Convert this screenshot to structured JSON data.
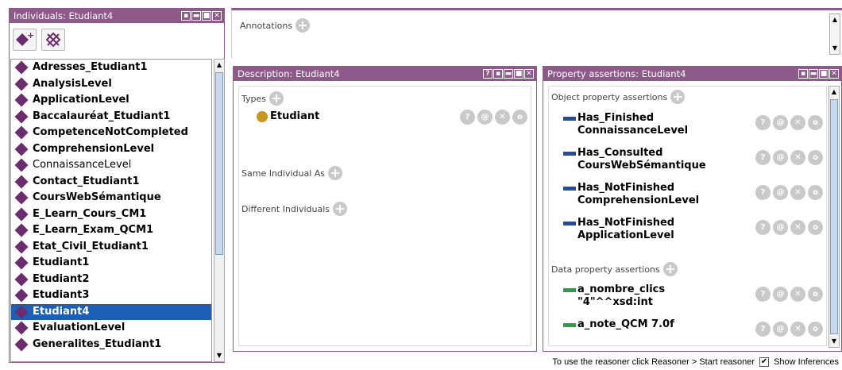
{
  "individuals_panel": {
    "title": "Individuals: Etudiant4",
    "items": [
      {
        "label": "Adresses_Etudiant1",
        "bold": true
      },
      {
        "label": "AnalysisLevel",
        "bold": true
      },
      {
        "label": "ApplicationLevel",
        "bold": true
      },
      {
        "label": "Baccalauréat_Etudiant1",
        "bold": true
      },
      {
        "label": "CompetenceNotCompleted",
        "bold": true
      },
      {
        "label": "ComprehensionLevel",
        "bold": true
      },
      {
        "label": "ConnaissanceLevel",
        "bold": false
      },
      {
        "label": "Contact_Etudiant1",
        "bold": true
      },
      {
        "label": "CoursWebSémantique",
        "bold": true
      },
      {
        "label": "E_Learn_Cours_CM1",
        "bold": true
      },
      {
        "label": "E_Learn_Exam_QCM1",
        "bold": true
      },
      {
        "label": "Etat_Civil_Etudiant1",
        "bold": true
      },
      {
        "label": "Etudiant1",
        "bold": true
      },
      {
        "label": "Etudiant2",
        "bold": true
      },
      {
        "label": "Etudiant3",
        "bold": true
      },
      {
        "label": "Etudiant4",
        "bold": true,
        "selected": true
      },
      {
        "label": "EvaluationLevel",
        "bold": true
      },
      {
        "label": "Generalites_Etudiant1",
        "bold": true
      }
    ]
  },
  "annotations": {
    "label": "Annotations"
  },
  "description_panel": {
    "title": "Description: Etudiant4",
    "types_label": "Types",
    "type_value": "Etudiant",
    "same_label": "Same Individual As",
    "different_label": "Different Individuals"
  },
  "property_panel": {
    "title": "Property assertions: Etudiant4",
    "object_label": "Object property assertions",
    "object_assertions": [
      {
        "line1": "Has_Finished",
        "line2": "ConnaissanceLevel"
      },
      {
        "line1": "Has_Consulted",
        "line2": "CoursWebSémantique"
      },
      {
        "line1": "Has_NotFinished",
        "line2": "ComprehensionLevel"
      },
      {
        "line1": "Has_NotFinished",
        "line2": "ApplicationLevel"
      }
    ],
    "data_label": "Data property assertions",
    "data_assertions": [
      {
        "line1": "a_nombre_clics",
        "line2": "\"4\"^^xsd:int"
      },
      {
        "line1": "a_note_QCM  7.0f",
        "line2": ""
      }
    ]
  },
  "status_bar": {
    "hint": "To use the reasoner click Reasoner > Start reasoner",
    "check": "✔",
    "show_inferences": "Show Inferences"
  },
  "colors": {
    "titlebar": "#8e5a8a",
    "selection": "#1d5fb6",
    "individual_icon": "#6b2d6e",
    "object_prop": "#1f4f9c",
    "data_prop": "#2e9e44",
    "class_icon": "#c8961e"
  }
}
